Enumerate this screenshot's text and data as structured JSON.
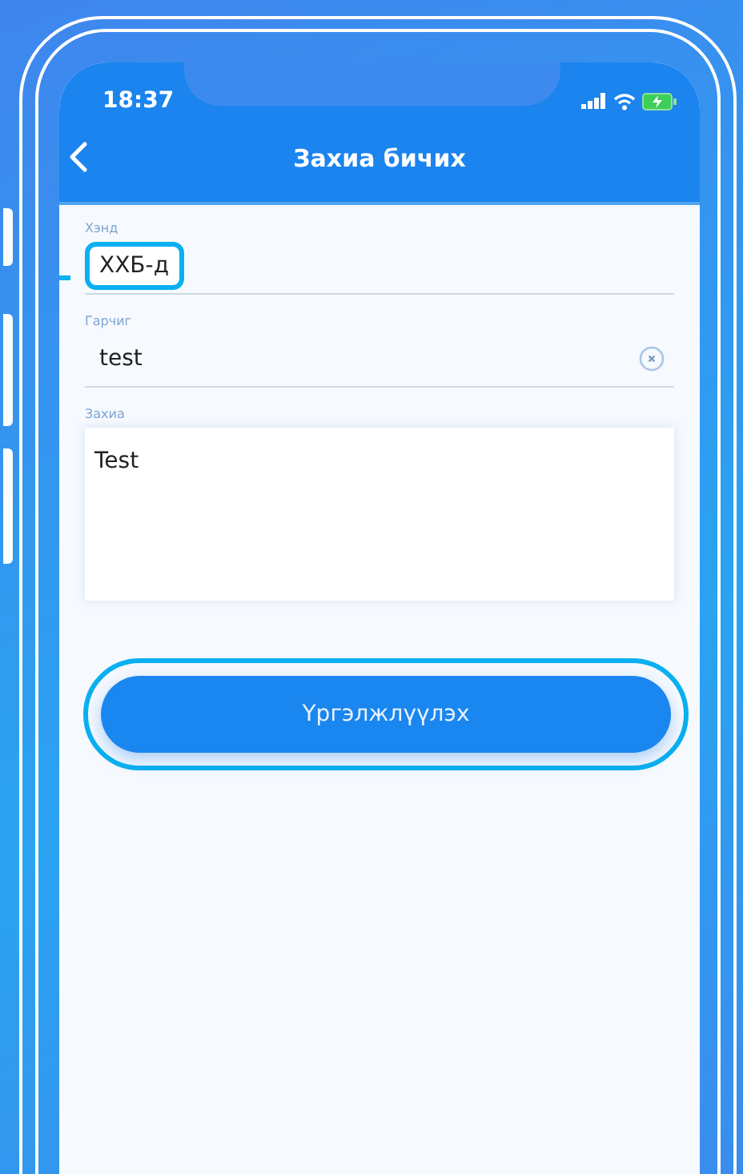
{
  "status_bar": {
    "time": "18:37"
  },
  "nav": {
    "title": "Захиа бичих"
  },
  "fields": [
    {
      "kind": "line",
      "label": "Хэнд",
      "value": "ХХБ-д",
      "highlighted": true,
      "clearable": false
    },
    {
      "kind": "line",
      "label": "Гарчиг",
      "value": "test",
      "highlighted": false,
      "clearable": true
    },
    {
      "kind": "area",
      "label": "Захиа",
      "value": "Test"
    }
  ],
  "button": {
    "label": "Үргэлжлүүлэх",
    "highlighted": true
  }
}
